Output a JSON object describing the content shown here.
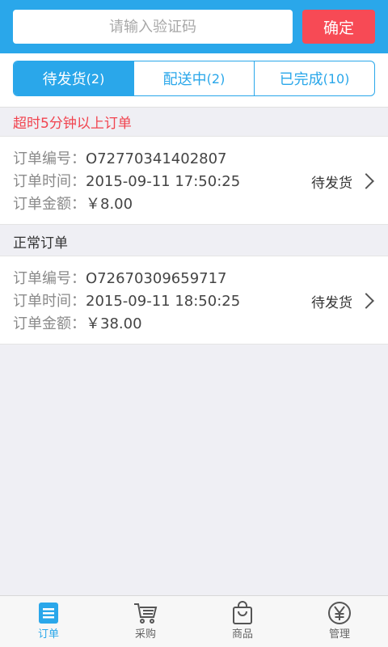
{
  "header": {
    "code_input_placeholder": "请输入验证码",
    "confirm_label": "确定"
  },
  "tabs": [
    {
      "label": "待发货",
      "count": "(2)",
      "active": true
    },
    {
      "label": "配送中",
      "count": "(2)",
      "active": false
    },
    {
      "label": "已完成",
      "count": "(10)",
      "active": false
    }
  ],
  "sections": {
    "overtime_title": "超时5分钟以上订单",
    "normal_title": "正常订单"
  },
  "labels": {
    "order_no": "订单编号：",
    "order_time": "订单时间：",
    "order_amount": "订单金额："
  },
  "orders": [
    {
      "number": "O72770341402807",
      "time": "2015-09-11 17:50:25",
      "amount": "￥8.00",
      "status": "待发货"
    },
    {
      "number": "O72670309659717",
      "time": "2015-09-11 18:50:25",
      "amount": "￥38.00",
      "status": "待发货"
    }
  ],
  "nav": [
    {
      "label": "订单",
      "icon": "list-icon",
      "active": true
    },
    {
      "label": "采购",
      "icon": "cart-icon",
      "active": false
    },
    {
      "label": "商品",
      "icon": "bag-icon",
      "active": false
    },
    {
      "label": "管理",
      "icon": "yen-circle-icon",
      "active": false
    }
  ],
  "colors": {
    "primary": "#2aa7ea",
    "confirm": "#f74a55",
    "alert_text": "#f1444f",
    "background": "#efeff4"
  }
}
